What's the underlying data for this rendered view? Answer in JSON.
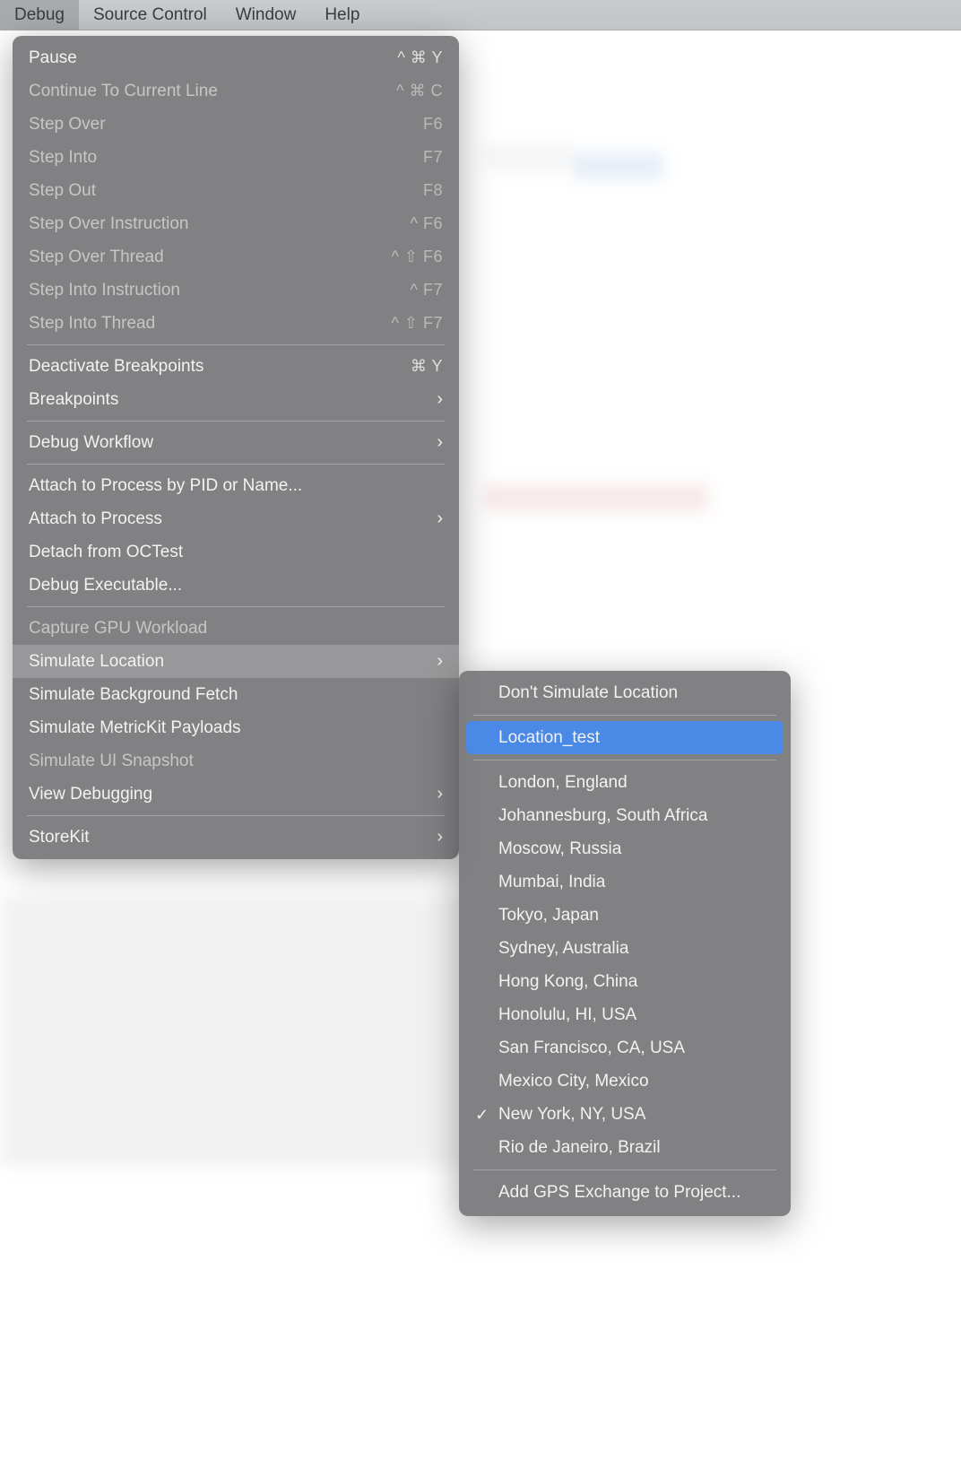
{
  "menubar": {
    "items": [
      {
        "label": "Debug",
        "active": true
      },
      {
        "label": "Source Control",
        "active": false
      },
      {
        "label": "Window",
        "active": false
      },
      {
        "label": "Help",
        "active": false
      }
    ]
  },
  "dropdown": {
    "sections": [
      [
        {
          "label": "Pause",
          "shortcut": "^ ⌘ Y",
          "enabled": true,
          "submenu": false,
          "highlight": false
        },
        {
          "label": "Continue To Current Line",
          "shortcut": "^ ⌘ C",
          "enabled": false,
          "submenu": false,
          "highlight": false
        },
        {
          "label": "Step Over",
          "shortcut": "F6",
          "enabled": false,
          "submenu": false,
          "highlight": false
        },
        {
          "label": "Step Into",
          "shortcut": "F7",
          "enabled": false,
          "submenu": false,
          "highlight": false
        },
        {
          "label": "Step Out",
          "shortcut": "F8",
          "enabled": false,
          "submenu": false,
          "highlight": false
        },
        {
          "label": "Step Over Instruction",
          "shortcut": "^ F6",
          "enabled": false,
          "submenu": false,
          "highlight": false
        },
        {
          "label": "Step Over Thread",
          "shortcut": "^ ⇧ F6",
          "enabled": false,
          "submenu": false,
          "highlight": false
        },
        {
          "label": "Step Into Instruction",
          "shortcut": "^ F7",
          "enabled": false,
          "submenu": false,
          "highlight": false
        },
        {
          "label": "Step Into Thread",
          "shortcut": "^ ⇧ F7",
          "enabled": false,
          "submenu": false,
          "highlight": false
        }
      ],
      [
        {
          "label": "Deactivate Breakpoints",
          "shortcut": "⌘ Y",
          "enabled": true,
          "submenu": false,
          "highlight": false
        },
        {
          "label": "Breakpoints",
          "shortcut": "",
          "enabled": true,
          "submenu": true,
          "highlight": false
        }
      ],
      [
        {
          "label": "Debug Workflow",
          "shortcut": "",
          "enabled": true,
          "submenu": true,
          "highlight": false
        }
      ],
      [
        {
          "label": "Attach to Process by PID or Name...",
          "shortcut": "",
          "enabled": true,
          "submenu": false,
          "highlight": false
        },
        {
          "label": "Attach to Process",
          "shortcut": "",
          "enabled": true,
          "submenu": true,
          "highlight": false
        },
        {
          "label": "Detach from OCTest",
          "shortcut": "",
          "enabled": true,
          "submenu": false,
          "highlight": false
        },
        {
          "label": "Debug Executable...",
          "shortcut": "",
          "enabled": true,
          "submenu": false,
          "highlight": false
        }
      ],
      [
        {
          "label": "Capture GPU Workload",
          "shortcut": "",
          "enabled": false,
          "submenu": false,
          "highlight": false
        },
        {
          "label": "Simulate Location",
          "shortcut": "",
          "enabled": true,
          "submenu": true,
          "highlight": true
        },
        {
          "label": "Simulate Background Fetch",
          "shortcut": "",
          "enabled": true,
          "submenu": false,
          "highlight": false
        },
        {
          "label": "Simulate MetricKit Payloads",
          "shortcut": "",
          "enabled": true,
          "submenu": false,
          "highlight": false
        },
        {
          "label": "Simulate UI Snapshot",
          "shortcut": "",
          "enabled": false,
          "submenu": false,
          "highlight": false
        },
        {
          "label": "View Debugging",
          "shortcut": "",
          "enabled": true,
          "submenu": true,
          "highlight": false
        }
      ],
      [
        {
          "label": "StoreKit",
          "shortcut": "",
          "enabled": true,
          "submenu": true,
          "highlight": false
        }
      ]
    ]
  },
  "submenu": {
    "sections": [
      [
        {
          "label": "Don't Simulate Location",
          "checked": false,
          "selected": false
        }
      ],
      [
        {
          "label": "Location_test",
          "checked": false,
          "selected": true
        }
      ],
      [
        {
          "label": "London, England",
          "checked": false,
          "selected": false
        },
        {
          "label": "Johannesburg, South Africa",
          "checked": false,
          "selected": false
        },
        {
          "label": "Moscow, Russia",
          "checked": false,
          "selected": false
        },
        {
          "label": "Mumbai, India",
          "checked": false,
          "selected": false
        },
        {
          "label": "Tokyo, Japan",
          "checked": false,
          "selected": false
        },
        {
          "label": "Sydney, Australia",
          "checked": false,
          "selected": false
        },
        {
          "label": "Hong Kong, China",
          "checked": false,
          "selected": false
        },
        {
          "label": "Honolulu, HI, USA",
          "checked": false,
          "selected": false
        },
        {
          "label": "San Francisco, CA, USA",
          "checked": false,
          "selected": false
        },
        {
          "label": "Mexico City, Mexico",
          "checked": false,
          "selected": false
        },
        {
          "label": "New York, NY, USA",
          "checked": true,
          "selected": false
        },
        {
          "label": "Rio de Janeiro, Brazil",
          "checked": false,
          "selected": false
        }
      ],
      [
        {
          "label": "Add GPS Exchange to Project...",
          "checked": false,
          "selected": false
        }
      ]
    ]
  }
}
